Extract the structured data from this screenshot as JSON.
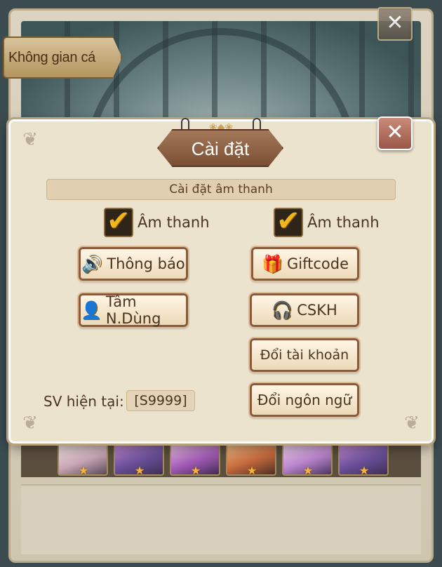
{
  "background": {
    "tab_label": "Không gian cá nhân",
    "hero_rarity_icon": "star-icon",
    "close_icon": "close-icon"
  },
  "dialog": {
    "title": "Cài đặt",
    "close_icon": "close-icon",
    "section_title": "Cài đặt âm thanh",
    "toggles": [
      {
        "label": "Âm thanh",
        "checked": true,
        "icon": "checkmark-icon"
      },
      {
        "label": "Âm thanh",
        "checked": true,
        "icon": "checkmark-icon"
      }
    ],
    "buttons": {
      "notification": {
        "label": "Thông báo",
        "icon": "speaker-icon"
      },
      "giftcode": {
        "label": "Giftcode",
        "icon": "gift-icon"
      },
      "account": {
        "label": "Tâm N.Dùng",
        "icon": "user-icon"
      },
      "support": {
        "label": "CSKH",
        "icon": "headset-icon"
      },
      "switch_account": {
        "label": "Đổi tài khoản"
      },
      "change_language": {
        "label": "Đổi ngôn ngữ"
      }
    },
    "server": {
      "label": "SV hiện tại:",
      "value": "[S9999]"
    }
  },
  "colors": {
    "accent_gold": "#f2b51c",
    "title_brown": "#7a4f33",
    "panel_bg": "#ece3cf"
  }
}
